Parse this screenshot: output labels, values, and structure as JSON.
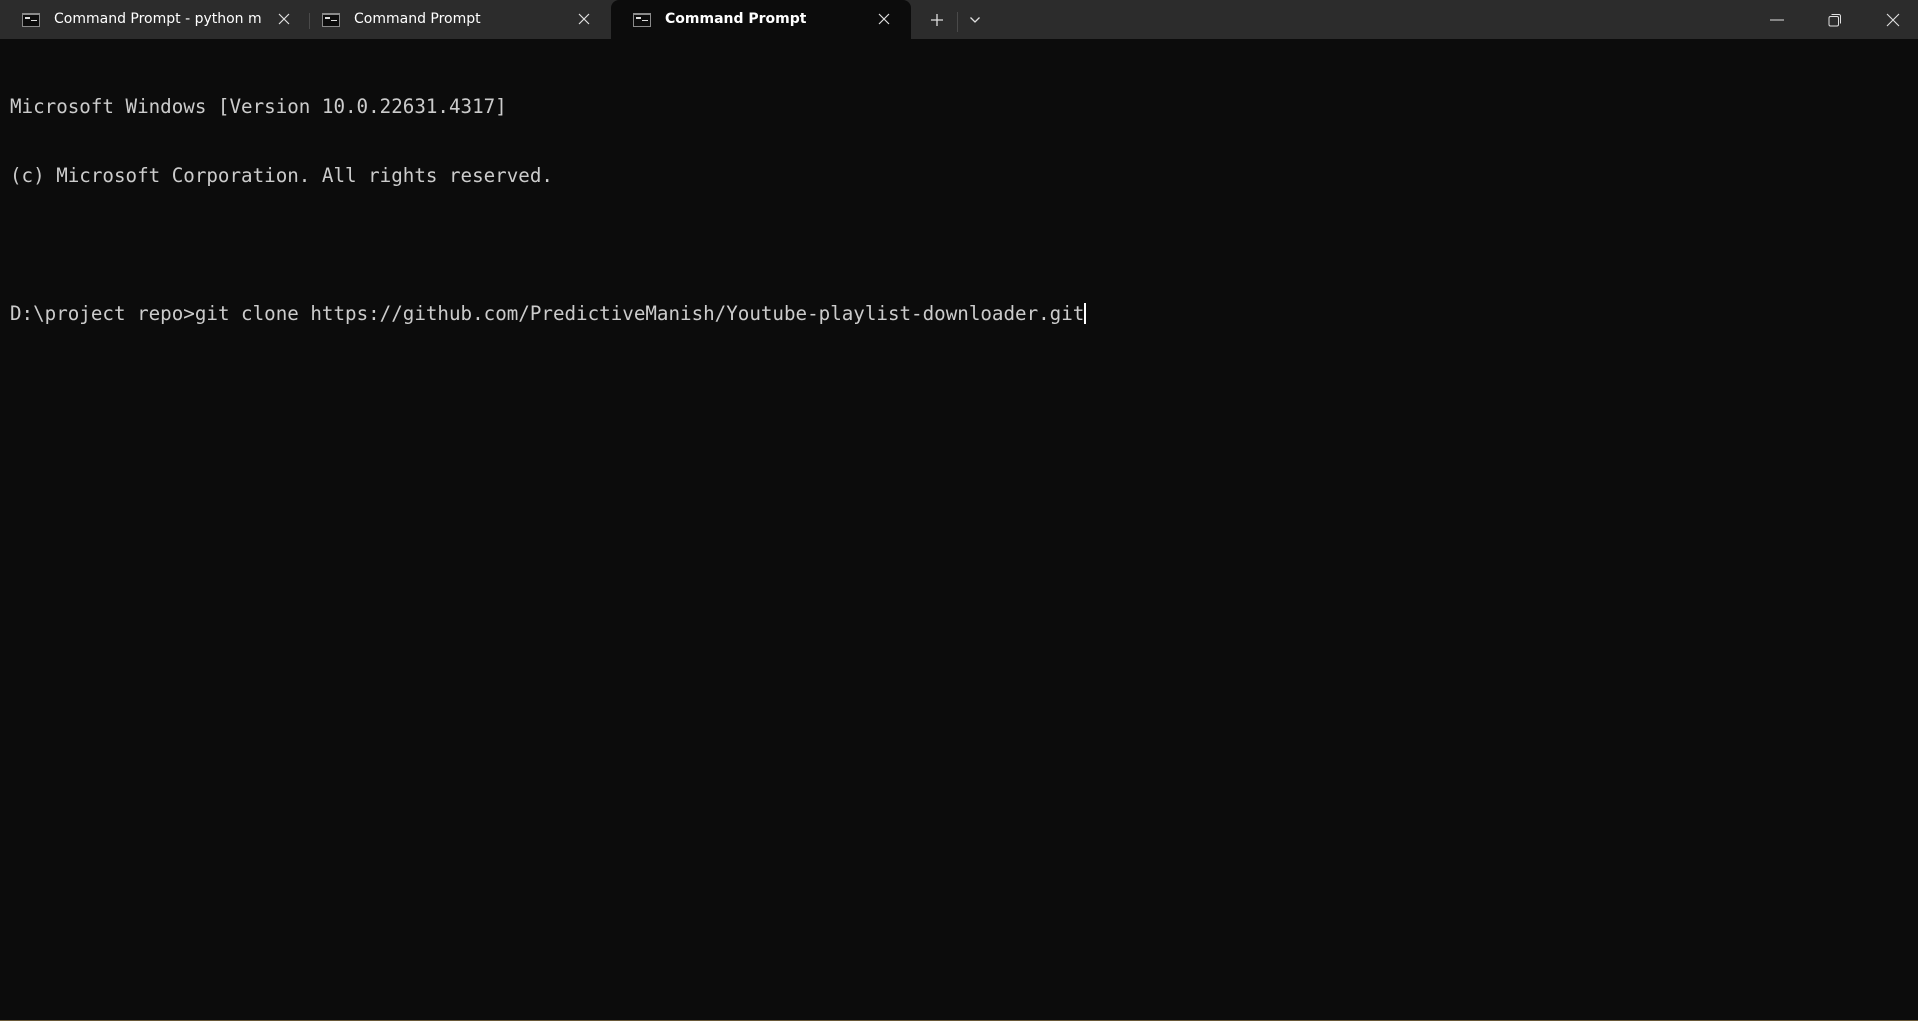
{
  "window": {
    "tabs": [
      {
        "title": "Command Prompt - python  m",
        "icon": "cmd-icon",
        "active": false
      },
      {
        "title": "Command Prompt",
        "icon": "cmd-icon",
        "active": false
      },
      {
        "title": "Command Prompt",
        "icon": "cmd-icon",
        "active": true
      }
    ],
    "new_tab_icon": "plus-icon",
    "dropdown_icon": "chevron-down-icon",
    "controls": {
      "minimize": "minimize-icon",
      "restore": "restore-icon",
      "close": "close-icon"
    }
  },
  "terminal": {
    "lines": [
      "Microsoft Windows [Version 10.0.22631.4317]",
      "(c) Microsoft Corporation. All rights reserved.",
      ""
    ],
    "prompt": "D:\\project repo>",
    "command": "git clone https://github.com/PredictiveManish/Youtube-playlist-downloader.git"
  },
  "colors": {
    "background": "#0c0c0c",
    "titlebar": "#2c2c2c",
    "text": "#cccccc"
  }
}
